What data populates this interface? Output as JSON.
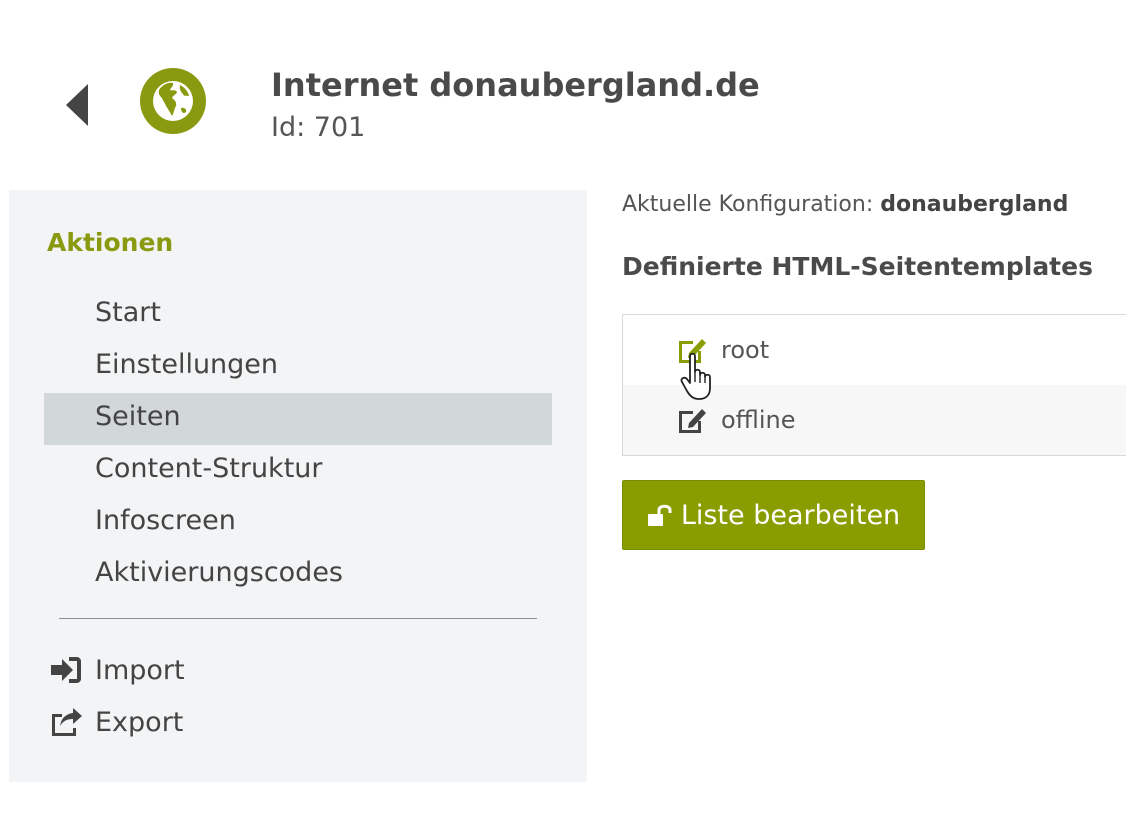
{
  "header": {
    "back_icon": "caret-left-icon",
    "site_icon": "globe-icon",
    "title": "Internet donaubergland.de",
    "id_label": "Id: 701"
  },
  "sidebar": {
    "heading": "Aktionen",
    "items": [
      {
        "label": "Start",
        "active": false
      },
      {
        "label": "Einstellungen",
        "active": false
      },
      {
        "label": "Seiten",
        "active": true
      },
      {
        "label": "Content-Struktur",
        "active": false
      },
      {
        "label": "Infoscreen",
        "active": false
      },
      {
        "label": "Aktivierungscodes",
        "active": false
      }
    ],
    "tools": [
      {
        "label": "Import",
        "icon": "sign-in-icon"
      },
      {
        "label": "Export",
        "icon": "share-square-icon"
      }
    ]
  },
  "main": {
    "config_label": "Aktuelle Konfiguration:",
    "config_value": "donaubergland",
    "section_title": "Definierte HTML-Seitentemplates",
    "templates": [
      {
        "label": "root",
        "icon": "edit-icon",
        "hovered": true
      },
      {
        "label": "offline",
        "icon": "edit-icon",
        "hovered": false
      }
    ],
    "edit_button_label": "Liste bearbeiten",
    "edit_button_icon": "unlock-icon"
  },
  "colors": {
    "accent": "#899d00",
    "heading_accent": "#8a9a10",
    "sidebar_bg": "#f3f4f5",
    "active_item_bg": "#d2d7d9",
    "text": "#444444"
  }
}
